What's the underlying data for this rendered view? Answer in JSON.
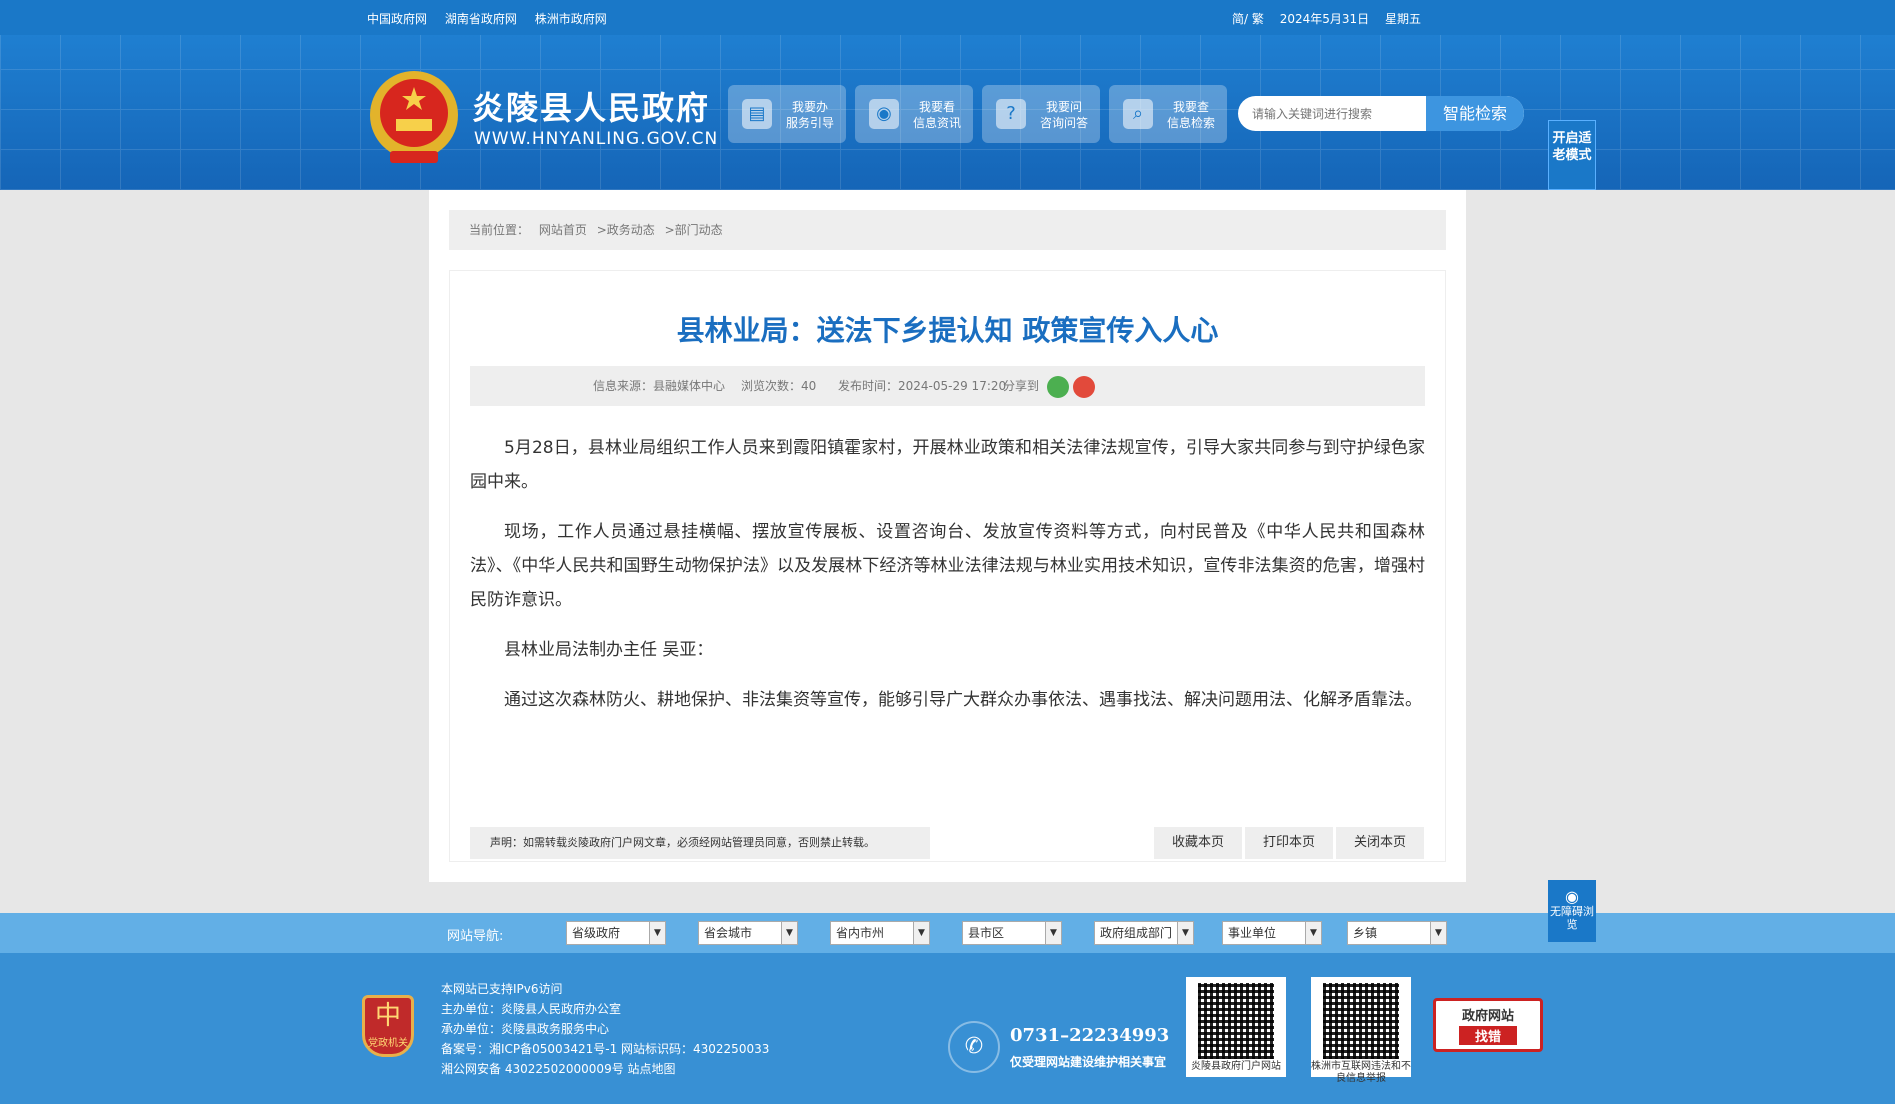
{
  "topbar": {
    "links": [
      "中国政府网",
      "湖南省政府网",
      "株洲市政府网"
    ],
    "lang": "简/ 繁",
    "date": "2024年5月31日",
    "weekday": "星期五"
  },
  "header": {
    "title": "炎陵县人民政府",
    "url": "WWW.HNYANLING.GOV.CN",
    "nav": [
      {
        "line1": "我要办",
        "line2": "服务引导",
        "icon": "document-icon"
      },
      {
        "line1": "我要看",
        "line2": "信息资讯",
        "icon": "eye-icon"
      },
      {
        "line1": "我要问",
        "line2": "咨询问答",
        "icon": "question-icon"
      },
      {
        "line1": "我要查",
        "line2": "信息检索",
        "icon": "magnifier-icon"
      }
    ],
    "search_placeholder": "请输入关键词进行搜索",
    "search_button": "智能检索",
    "elder_mode": "开启适老模式"
  },
  "breadcrumb": {
    "prefix": "当前位置：",
    "items": [
      "网站首页",
      ">政务动态",
      ">部门动态"
    ]
  },
  "article": {
    "title": "县林业局：送法下乡提认知 政策宣传入人心",
    "source": "信息来源：县融媒体中心",
    "views": "浏览次数：40",
    "time": "发布时间：2024-05-29 17:20",
    "share": "分享到",
    "paragraphs": [
      "5月28日，县林业局组织工作人员来到霞阳镇霍家村，开展林业政策和相关法律法规宣传，引导大家共同参与到守护绿色家园中来。",
      "现场，工作人员通过悬挂横幅、摆放宣传展板、设置咨询台、发放宣传资料等方式，向村民普及《中华人民共和国森林法》、《中华人民共和国野生动物保护法》以及发展林下经济等林业法律法规与林业实用技术知识，宣传非法集资的危害，增强村民防诈意识。",
      "县林业局法制办主任 吴亚：",
      "通过这次森林防火、耕地保护、非法集资等宣传，能够引导广大群众办事依法、遇事找法、解决问题用法、化解矛盾靠法。"
    ],
    "notice": "声明：如需转载炎陵政府门户网文章，必须经网站管理员同意，否则禁止转载。",
    "tools": [
      "收藏本页",
      "打印本页",
      "关闭本页"
    ]
  },
  "sitenav": {
    "label": "网站导航:",
    "selects": [
      "省级政府",
      "省会城市",
      "省内市州",
      "县市区",
      "政府组成部门",
      "事业单位",
      "乡镇"
    ]
  },
  "footer": {
    "badge": "党政机关",
    "lines": [
      "本网站已支持IPv6访问",
      "主办单位：炎陵县人民政府办公室",
      "承办单位：炎陵县政务服务中心",
      "备案号：湘ICP备05003421号-1 网站标识码：4302250033",
      "湘公网安备 43022502000009号 站点地图"
    ],
    "phone": "0731–22234993",
    "phone_note": "仅受理网站建设维护相关事宜",
    "qr1": "炎陵县政府门户网站",
    "qr2": "株洲市互联网违法和不良信息举报",
    "jiucuo_top": "政府网站",
    "jiucuo_bottom": "找错"
  },
  "accessibility": "无障碍浏览",
  "colors": {
    "primary": "#1a78c8",
    "title": "#1a6ec0",
    "nav_strip": "#62afe6",
    "footer": "#3890d4"
  }
}
